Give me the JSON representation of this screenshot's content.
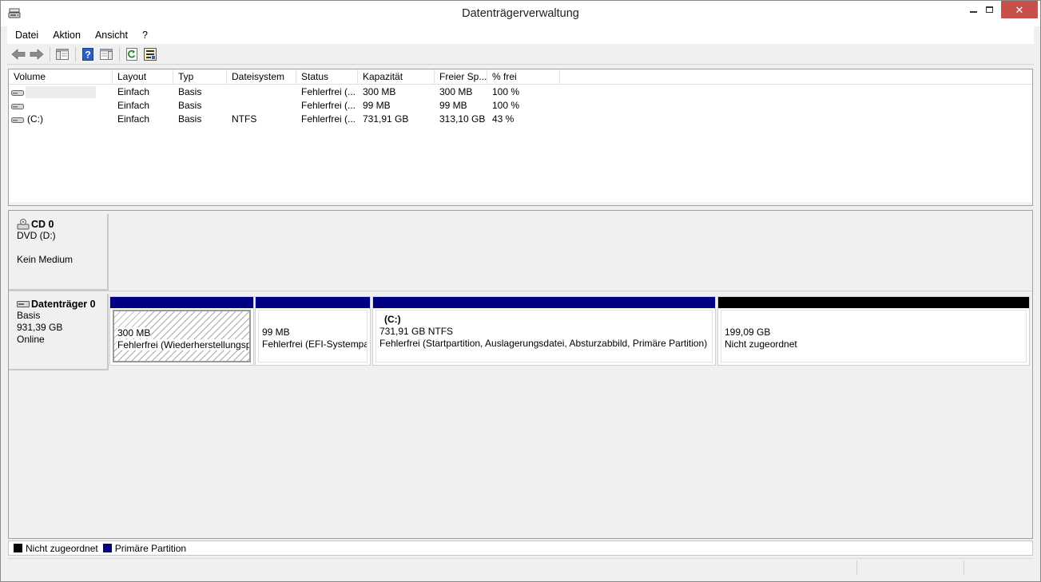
{
  "window": {
    "title": "Datenträgerverwaltung",
    "close_glyph": "✕"
  },
  "menu": [
    "Datei",
    "Aktion",
    "Ansicht",
    "?"
  ],
  "toolbar": {
    "buttons": [
      "back-arrow-icon",
      "forward-arrow-icon",
      "console-tree-icon",
      "help-icon",
      "show-hide-pane-icon",
      "refresh-icon",
      "properties-icon"
    ]
  },
  "volume_list": {
    "columns": [
      "Volume",
      "Layout",
      "Typ",
      "Dateisystem",
      "Status",
      "Kapazität",
      "Freier Sp...",
      "% frei"
    ],
    "rows": [
      {
        "volume": "",
        "layout": "Einfach",
        "typ": "Basis",
        "dateisystem": "",
        "status": "Fehlerfrei (...",
        "kapazitaet": "300 MB",
        "frei": "300 MB",
        "prozent": "100 %"
      },
      {
        "volume": "",
        "layout": "Einfach",
        "typ": "Basis",
        "dateisystem": "",
        "status": "Fehlerfrei (...",
        "kapazitaet": "99 MB",
        "frei": "99 MB",
        "prozent": "100 %"
      },
      {
        "volume": "(C:)",
        "layout": "Einfach",
        "typ": "Basis",
        "dateisystem": "NTFS",
        "status": "Fehlerfrei (...",
        "kapazitaet": "731,91 GB",
        "frei": "313,10 GB",
        "prozent": "43 %"
      }
    ]
  },
  "disks": [
    {
      "name": "CD 0",
      "line1": "DVD (D:)",
      "line2": "Kein Medium"
    },
    {
      "name": "Datenträger 0",
      "line1": "Basis",
      "line2": "931,39 GB",
      "line3": "Online"
    }
  ],
  "partitions": [
    {
      "name": "",
      "size": "300 MB",
      "status": "Fehlerfrei (Wiederherstellungspartition)",
      "kind": "primary"
    },
    {
      "name": "",
      "size": "99 MB",
      "status": "Fehlerfrei (EFI-Systempartition)",
      "kind": "primary"
    },
    {
      "name": "(C:)",
      "size": "731,91 GB NTFS",
      "status": "Fehlerfrei (Startpartition, Auslagerungsdatei, Absturzabbild, Primäre Partition)",
      "kind": "primary"
    },
    {
      "name": "",
      "size": "199,09 GB",
      "status": "Nicht zugeordnet",
      "kind": "unallocated"
    }
  ],
  "legend": [
    {
      "label": "Nicht zugeordnet",
      "color": "#000000"
    },
    {
      "label": "Primäre Partition",
      "color": "#000080"
    }
  ],
  "colors": {
    "primary": "#000080",
    "unallocated": "#000000",
    "close_button": "#c7504b"
  }
}
